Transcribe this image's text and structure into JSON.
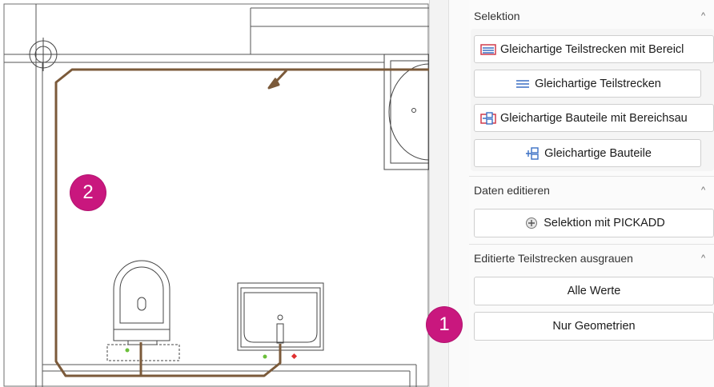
{
  "panel": {
    "sections": [
      {
        "title": "Selektion",
        "chevron": "^"
      },
      {
        "title": "Daten editieren",
        "chevron": "^"
      },
      {
        "title": "Editierte Teilstrecken ausgrauen",
        "chevron": "^"
      }
    ],
    "selektion_buttons": [
      {
        "label": "Gleichartige Teilstrecken mit Bereicl",
        "icon": "segments-range-icon"
      },
      {
        "label": "Gleichartige Teilstrecken",
        "icon": "segments-icon"
      },
      {
        "label": "Gleichartige Bauteile mit Bereichsau",
        "icon": "components-range-icon"
      },
      {
        "label": "Gleichartige Bauteile",
        "icon": "components-icon"
      }
    ],
    "daten_button": {
      "label": "Selektion mit PICKADD",
      "icon": "pickadd-icon"
    },
    "ausgrauen_buttons": [
      {
        "label": "Alle Werte"
      },
      {
        "label": "Nur Geometrien"
      }
    ]
  },
  "badges": {
    "one": "1",
    "two": "2"
  },
  "colors": {
    "pipe": "#7b5a3a",
    "badge": "#c9177e",
    "dot_green": "#6bbf3a",
    "dot_red": "#e03030"
  }
}
